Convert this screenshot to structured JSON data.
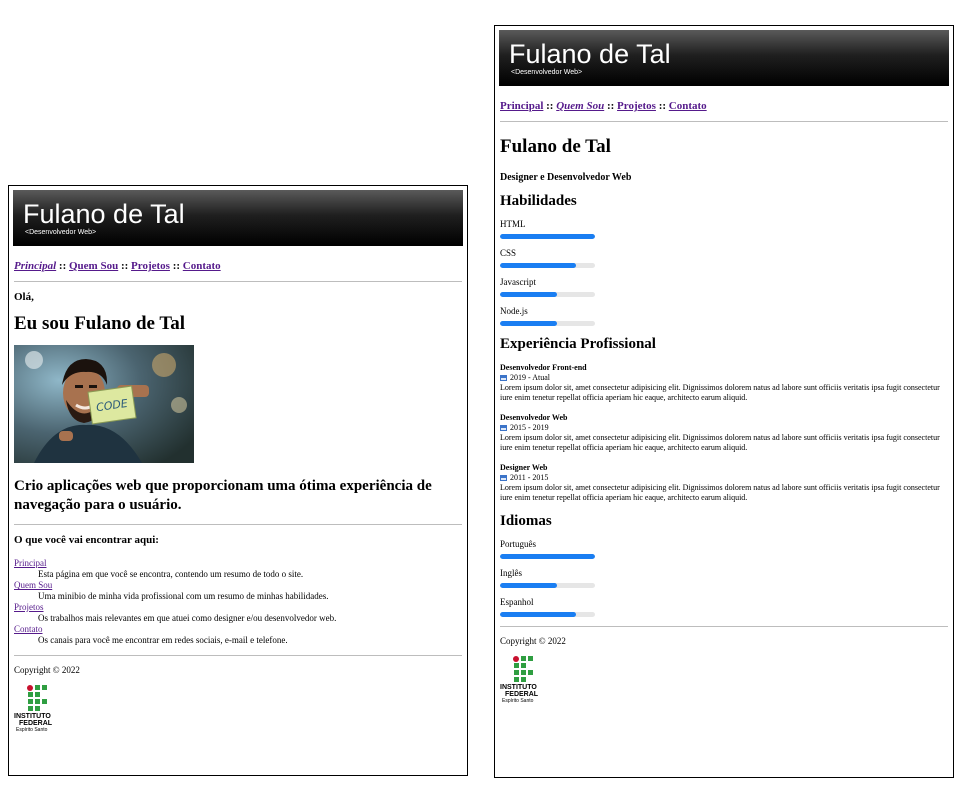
{
  "header": {
    "title": "Fulano de Tal",
    "subtitle": "<Desenvolvedor Web>"
  },
  "nav": {
    "items": [
      "Principal",
      "Quem Sou",
      "Projetos",
      "Contato"
    ],
    "separator": "::"
  },
  "home": {
    "greeting": "Olá,",
    "heading": "Eu sou Fulano de Tal",
    "photo_text": "CODE",
    "tagline": "Crio aplicações web que proporcionam uma ótima experiência de navegação para o usuário.",
    "find_heading": "O que você vai encontrar aqui:",
    "sections": [
      {
        "link": "Principal",
        "desc": "Esta página em que você se encontra, contendo um resumo de todo o site."
      },
      {
        "link": "Quem Sou",
        "desc": "Uma minibio de minha vida profissional com um resumo de minhas habilidades."
      },
      {
        "link": "Projetos",
        "desc": "Os trabalhos mais relevantes em que atuei como designer e/ou desenvolvedor web."
      },
      {
        "link": "Contato",
        "desc": "Os canais para você me encontrar em redes sociais, e-mail e telefone."
      }
    ]
  },
  "about": {
    "name": "Fulano de Tal",
    "role": "Designer e Desenvolvedor Web",
    "skills_heading": "Habilidades",
    "skills": [
      {
        "name": "HTML",
        "level": 1.0
      },
      {
        "name": "CSS",
        "level": 0.8
      },
      {
        "name": "Javascript",
        "level": 0.6
      },
      {
        "name": "Node.js",
        "level": 0.6
      }
    ],
    "experience_heading": "Experiência Profissional",
    "jobs": [
      {
        "title": "Desenvolvedor Front-end",
        "period": "2019 - Atual",
        "desc": "Lorem ipsum dolor sit, amet consectetur adipisicing elit. Dignissimos dolorem natus ad labore sunt officiis veritatis ipsa fugit consectetur iure enim tenetur repellat officia aperiam hic eaque, architecto earum aliquid."
      },
      {
        "title": "Desenvolvedor Web",
        "period": "2015 - 2019",
        "desc": "Lorem ipsum dolor sit, amet consectetur adipisicing elit. Dignissimos dolorem natus ad labore sunt officiis veritatis ipsa fugit consectetur iure enim tenetur repellat officia aperiam hic eaque, architecto earum aliquid."
      },
      {
        "title": "Designer Web",
        "period": "2011 - 2015",
        "desc": "Lorem ipsum dolor sit, amet consectetur adipisicing elit. Dignissimos dolorem natus ad labore sunt officiis veritatis ipsa fugit consectetur iure enim tenetur repellat officia aperiam hic eaque, architecto earum aliquid."
      }
    ],
    "languages_heading": "Idiomas",
    "languages": [
      {
        "name": "Português",
        "level": 1.0
      },
      {
        "name": "Inglês",
        "level": 0.6
      },
      {
        "name": "Espanhol",
        "level": 0.8
      }
    ]
  },
  "footer": {
    "copyright": "Copyright © 2022",
    "logo_line1": "INSTITUTO",
    "logo_line2": "FEDERAL",
    "logo_line3": "Espírito Santo"
  },
  "colors": {
    "accent": "#1a7ef2",
    "link": "#551a8b",
    "header_bg": "#000000"
  }
}
